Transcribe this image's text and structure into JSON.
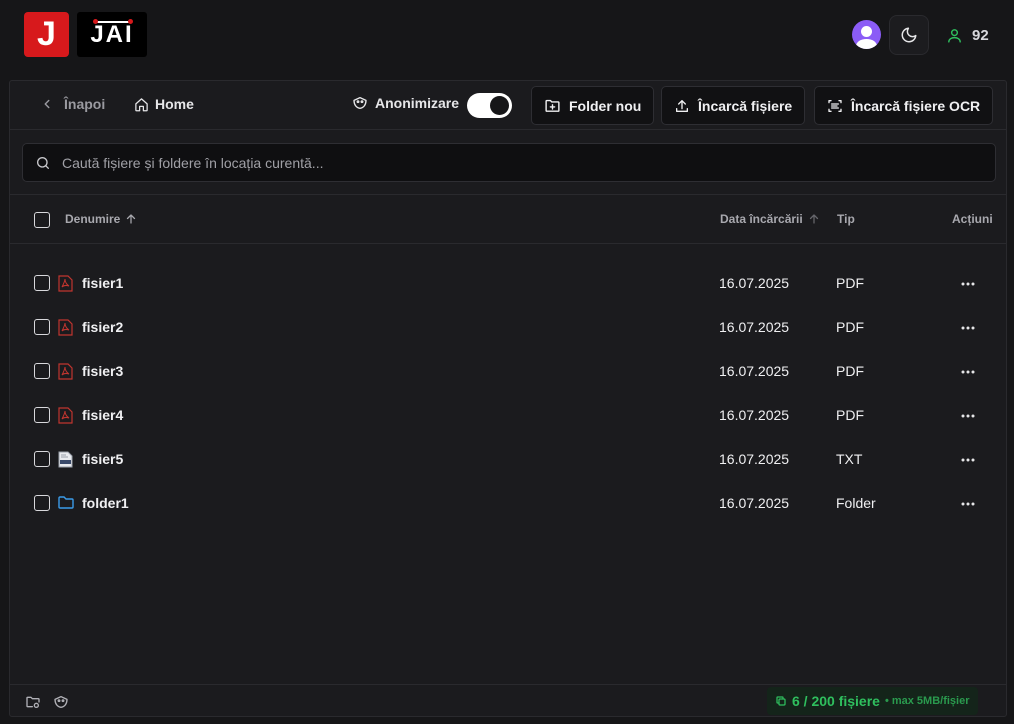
{
  "header": {
    "logo_letter": "J",
    "logo_text": "JAI",
    "user_count": "92",
    "colors": {
      "brand_red": "#d7191c",
      "avatar": "#8b5cf6",
      "accent_green": "#2fbf5e"
    }
  },
  "toolbar": {
    "back_label": "Înapoi",
    "home_label": "Home",
    "anon_label": "Anonimizare",
    "anon_enabled": true,
    "new_folder_label": "Folder nou",
    "upload_label": "Încarcă fișiere",
    "upload_ocr_label": "Încarcă fișiere OCR"
  },
  "search": {
    "placeholder": "Caută fișiere și foldere în locația curentă...",
    "value": ""
  },
  "table": {
    "columns": {
      "name": "Denumire",
      "date": "Data încărcării",
      "type": "Tip",
      "actions": "Acțiuni"
    },
    "rows": [
      {
        "name": "fisier1",
        "date": "16.07.2025",
        "type": "PDF",
        "icon": "pdf-icon"
      },
      {
        "name": "fisier2",
        "date": "16.07.2025",
        "type": "PDF",
        "icon": "pdf-icon"
      },
      {
        "name": "fisier3",
        "date": "16.07.2025",
        "type": "PDF",
        "icon": "pdf-icon"
      },
      {
        "name": "fisier4",
        "date": "16.07.2025",
        "type": "PDF",
        "icon": "pdf-icon"
      },
      {
        "name": "fisier5",
        "date": "16.07.2025",
        "type": "TXT",
        "icon": "txt-file-icon"
      },
      {
        "name": "folder1",
        "date": "16.07.2025",
        "type": "Folder",
        "icon": "folder-icon"
      }
    ]
  },
  "footer": {
    "quota_label": "6 / 200 fișiere",
    "quota_sub": "• max 5MB/fișier"
  }
}
